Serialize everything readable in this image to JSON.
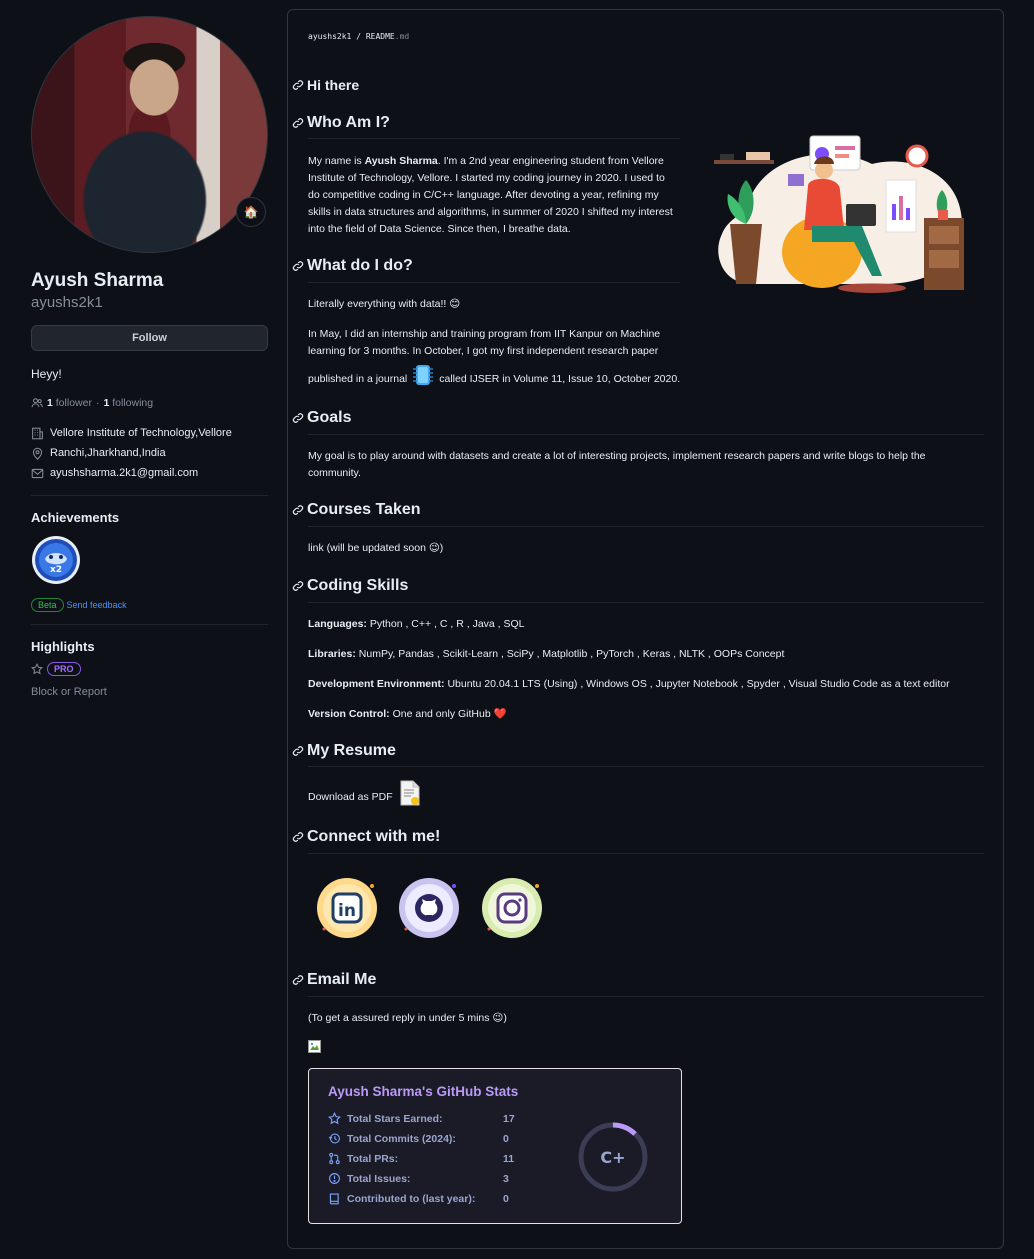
{
  "profile": {
    "name": "Ayush Sharma",
    "login": "ayushs2k1",
    "status_emoji": "🏠",
    "follow_label": "Follow",
    "bio": "Heyy!",
    "followers_count": "1",
    "followers_label": "follower",
    "dot": "·",
    "following_count": "1",
    "following_label": "following",
    "organization": "Vellore Institute of Technology,Vellore",
    "location": "Ranchi,Jharkhand,India",
    "email": "ayushsharma.2k1@gmail.com",
    "achievements_title": "Achievements",
    "beta_label": "Beta",
    "feedback_label": "Send feedback",
    "highlights_title": "Highlights",
    "pro_label": "PRO",
    "block_label": "Block or Report"
  },
  "readme": {
    "crumb_user": "ayushs2k1",
    "crumb_sep": "/",
    "crumb_file": "README",
    "crumb_ext": ".md",
    "h_hi": "Hi there",
    "h_who": "Who Am I?",
    "who_pre": "My name is ",
    "who_name": "Ayush Sharma",
    "who_l1_rest": ". I'm a 2nd year engineering student from Vellore",
    "who_l2": "Institute of Technology, Vellore. I started my coding journey in 2020. I used to",
    "who_l3": "do competitive coding in C/C++ language. After devoting a year, refining my",
    "who_l4": "skills in data structures and algorithms, in summer of 2020 I shifted my interest",
    "who_l5": "into the field of Data Science. Since then, I breathe data.",
    "h_what": "What do I do?",
    "what_p1": "Literally everything with data!! 😊",
    "what_l1": "In May, I did an internship and training program from IIT Kanpur on Machine",
    "what_l2": "learning for 3 months. In October, I got my first independent research paper",
    "what_l3a": "published in a journal",
    "what_l3b": "called IJSER in Volume 11, Issue 10, October 2020.",
    "h_goals": "Goals",
    "goals_l1": "My goal is to play around with datasets and create a lot of interesting projects, implement research papers and write blogs to help the",
    "goals_l2": "community.",
    "h_courses": "Courses Taken",
    "courses_p": "link (will be updated soon 😉)",
    "h_skills": "Coding Skills",
    "lang_k": "Languages:",
    "lang_v": " Python , C++ , C , R , Java , SQL",
    "lib_k": "Libraries:",
    "lib_v": " NumPy, Pandas , Scikit-Learn , SciPy , Matplotlib , PyTorch , Keras , NLTK , OOPs Concept",
    "env_k": "Development Environment:",
    "env_v": " Ubuntu 20.04.1 LTS (Using) , Windows OS , Jupyter Notebook , Spyder , Visual Studio Code as a text editor",
    "vc_k": "Version Control:",
    "vc_v": " One and only GitHub ❤️",
    "h_resume": "My Resume",
    "resume_p": "Download as PDF",
    "h_connect": "Connect with me!",
    "h_email": "Email Me",
    "email_p": "(To get a assured reply in under 5 mins 😉)"
  },
  "stats": {
    "title": "Ayush Sharma's GitHub Stats",
    "rows": [
      {
        "label": "Total Stars Earned:",
        "value": "17",
        "icon": "star-icon"
      },
      {
        "label": "Total Commits (2024):",
        "value": "0",
        "icon": "history-icon"
      },
      {
        "label": "Total PRs:",
        "value": "11",
        "icon": "pull-request-icon"
      },
      {
        "label": "Total Issues:",
        "value": "3",
        "icon": "issue-icon"
      },
      {
        "label": "Contributed to (last year):",
        "value": "0",
        "icon": "repo-icon"
      }
    ],
    "rank": "C+",
    "accent": "#bb9af7"
  }
}
